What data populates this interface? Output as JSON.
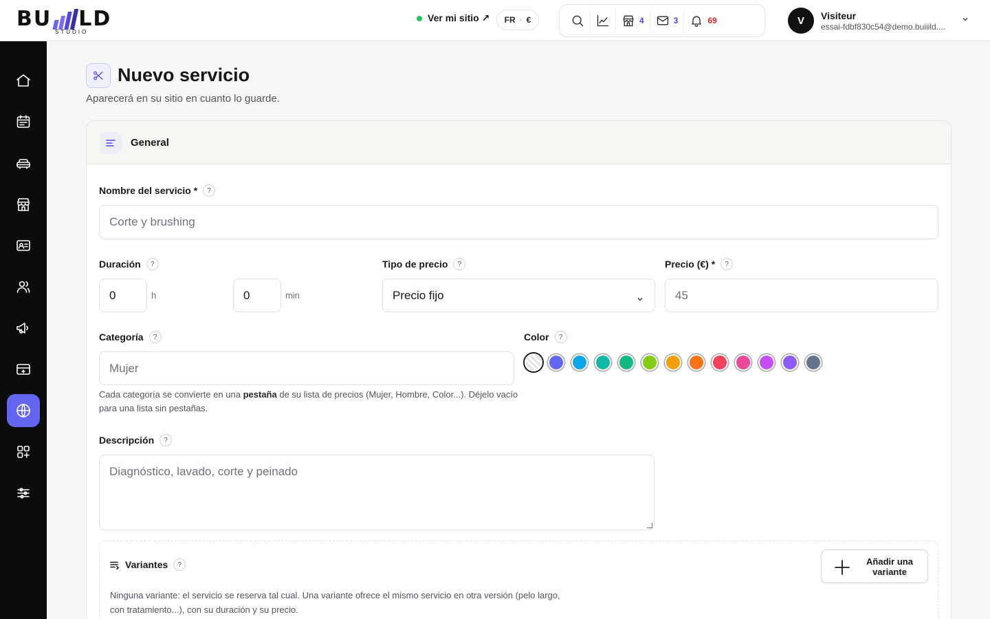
{
  "brand": {
    "word_left": "BU",
    "word_right": "LD",
    "sub": "STUDIO"
  },
  "topbar": {
    "site_link": "Ver mi sitio ↗",
    "lang": "FR",
    "currency": "€",
    "tools": {
      "shop_count": "4",
      "mail_count": "3",
      "bell_count": "69"
    },
    "user": {
      "initial": "V",
      "name": "Visiteur",
      "email": "essai-fdbf830c54@demo.buiiild...."
    }
  },
  "sidebar": {
    "items": [
      {
        "name": "home-icon"
      },
      {
        "name": "calendar-icon"
      },
      {
        "name": "services-icon"
      },
      {
        "name": "store-icon"
      },
      {
        "name": "contact-card-icon"
      },
      {
        "name": "users-icon"
      },
      {
        "name": "megaphone-icon"
      },
      {
        "name": "payment-icon"
      },
      {
        "name": "globe-icon",
        "active": true
      },
      {
        "name": "apps-add-icon"
      },
      {
        "name": "sliders-icon"
      }
    ]
  },
  "page": {
    "title": "Nuevo servicio",
    "subtitle": "Aparecerá en su sitio en cuanto lo guarde."
  },
  "card": {
    "title": "General",
    "name_label": "Nombre del servicio *",
    "name_placeholder": "Corte y brushing",
    "duration_label": "Duración",
    "hours_value": "0",
    "hours_unit": "h",
    "minutes_value": "0",
    "minutes_unit": "min",
    "price_type_label": "Tipo de precio",
    "price_type_value": "Precio fijo",
    "price_label": "Precio (€) *",
    "price_placeholder": "45",
    "category_label": "Categoría",
    "category_placeholder": "Mujer",
    "category_hint_pre": "Cada categoría se convierte en una ",
    "category_hint_bold": "pestaña",
    "category_hint_post": " de su lista de precios (Mujer, Hombre, Color...). Déjelo vacío para una lista sin pestañas.",
    "color_label": "Color",
    "colors": [
      "none",
      "#6366f1",
      "#0ea5e9",
      "#14b8a6",
      "#10b981",
      "#84cc16",
      "#f59e0b",
      "#f97316",
      "#f43f5e",
      "#ec4899",
      "#c34ff5",
      "#8b5cf6",
      "#64748b"
    ],
    "description_label": "Descripción",
    "description_placeholder": "Diagnóstico, lavado, corte y peinado",
    "variants_label": "Variantes",
    "add_variant": "Añadir una variante",
    "variants_hint": "Ninguna variante: el servicio se reserva tal cual. Una variante ofrece el mismo servicio en otra versión (pelo largo, con tratamiento...), con su duración y su precio.",
    "help": "?"
  }
}
